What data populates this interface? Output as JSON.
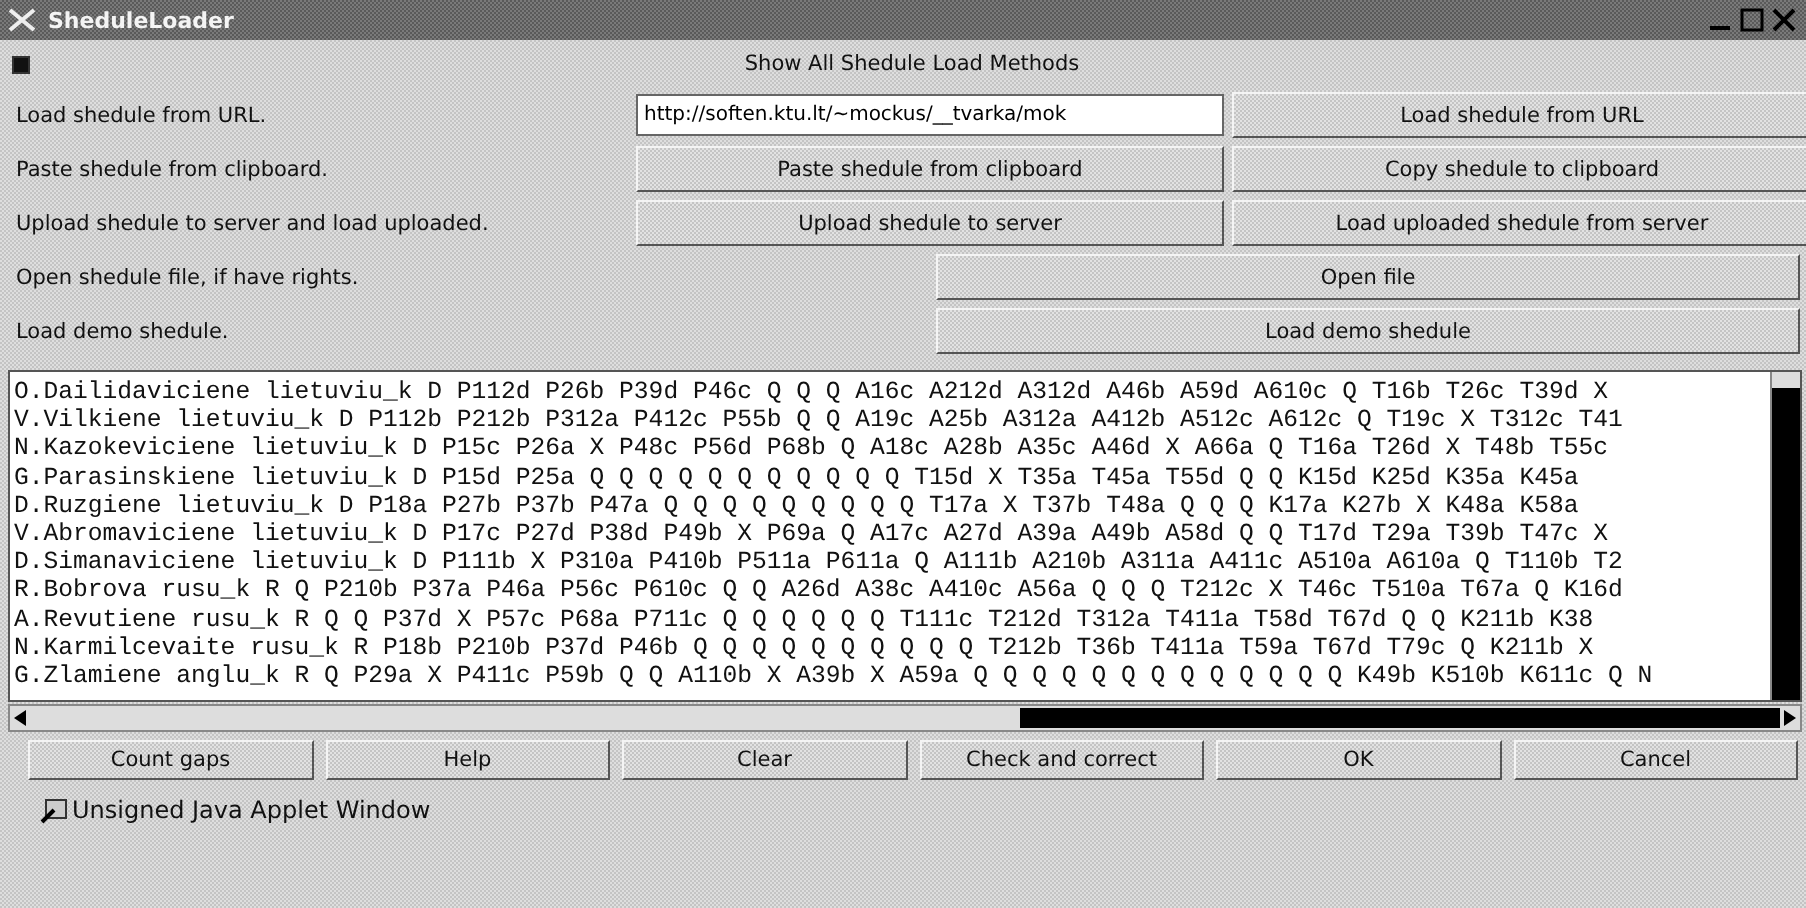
{
  "window": {
    "title": "SheduleLoader"
  },
  "show_all": {
    "label": "Show All Shedule Load Methods",
    "checked": true
  },
  "rows": [
    {
      "label": "Load shedule from URL.",
      "kind": "url",
      "value": "http://soften.ktu.lt/~mockus/__tvarka/mok",
      "buttons": [
        "Load shedule from URL"
      ]
    },
    {
      "label": "Paste shedule from clipboard.",
      "kind": "two",
      "buttons": [
        "Paste shedule from clipboard",
        "Copy shedule to clipboard"
      ]
    },
    {
      "label": "Upload shedule to server and load uploaded.",
      "kind": "two",
      "buttons": [
        "Upload shedule to server",
        "Load uploaded shedule from server"
      ]
    },
    {
      "label": "Open shedule file, if have rights.",
      "kind": "wide",
      "buttons": [
        "Open file"
      ]
    },
    {
      "label": "Load demo shedule.",
      "kind": "wide",
      "buttons": [
        "Load demo shedule"
      ]
    }
  ],
  "schedule_lines": [
    "O.Dailidaviciene lietuviu_k D P112d P26b P39d P46c Q Q Q A16c A212d A312d A46b A59d A610c Q T16b T26c T39d X",
    "V.Vilkiene lietuviu_k D P112b P212b P312a P412c P55b Q Q A19c A25b A312a A412b A512c A612c Q T19c X T312c T41",
    "N.Kazokeviciene lietuviu_k D P15c P26a X P48c P56d P68b Q A18c A28b A35c A46d X A66a Q T16a T26d X T48b T55c",
    "G.Parasinskiene lietuviu_k D P15d P25a Q Q Q Q Q Q Q Q Q Q Q T15d X T35a T45a T55d Q Q K15d K25d K35a K45a",
    "D.Ruzgiene lietuviu_k D P18a P27b P37b P47a Q Q Q Q Q Q Q Q Q T17a X T37b T48a Q Q Q K17a K27b X K48a K58a",
    "V.Abromaviciene lietuviu_k D P17c P27d P38d P49b X P69a Q A17c A27d A39a A49b A58d Q Q T17d T29a T39b T47c X",
    "D.Simanaviciene lietuviu_k D P111b X P310a P410b P511a P611a Q A111b A210b A311a A411c A510a A610a Q T110b T2",
    "R.Bobrova rusu_k R Q P210b P37a P46a P56c P610c Q Q A26d A38c A410c A56a Q Q Q T212c X T46c T510a T67a Q K16d",
    "A.Revutiene rusu_k R Q Q P37d X P57c P68a P711c Q Q Q Q Q Q T111c T212d T312a T411a T58d T67d Q Q K211b K38",
    "N.Karmilcevaite rusu_k R P18b P210b P37d P46b Q Q Q Q Q Q Q Q Q Q T212b T36b T411a T59a T67d T79c Q K211b X",
    "G.Zlamiene anglu_k R Q P29a X P411c P59b Q Q A110b X A39b X A59a Q Q Q Q Q Q Q Q Q Q Q Q Q K49b K510b K611c Q N"
  ],
  "bottom_buttons": [
    "Count gaps",
    "Help",
    "Clear",
    "Check and correct",
    "OK",
    "Cancel"
  ],
  "status_bar": "Unsigned Java Applet Window"
}
